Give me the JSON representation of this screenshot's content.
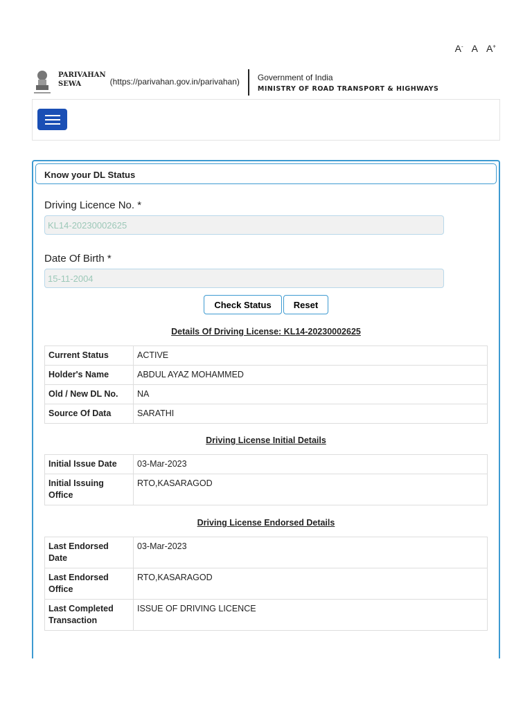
{
  "font_controls": {
    "decrease": "A",
    "decrease_sup": "-",
    "normal": "A",
    "increase": "A",
    "increase_sup": "+"
  },
  "header": {
    "brand_line1": "PARIVAHAN",
    "brand_line2": "SEWA",
    "url": "(https://parivahan.gov.in/parivahan)",
    "gov": "Government of India",
    "ministry": "MINISTRY OF ROAD TRANSPORT & HIGHWAYS"
  },
  "panel": {
    "title": "Know your DL Status",
    "dl_label": "Driving Licence No. *",
    "dl_value": "KL14-20230002625",
    "dob_label": "Date Of Birth *",
    "dob_value": "15-11-2004",
    "check_button": "Check Status",
    "reset_button": "Reset"
  },
  "sections": [
    {
      "title": "Details Of Driving License: KL14-20230002625",
      "rows": [
        [
          "Current Status",
          "ACTIVE"
        ],
        [
          "Holder's Name",
          "ABDUL AYAZ MOHAMMED"
        ],
        [
          "Old / New DL No.",
          "NA"
        ],
        [
          "Source Of Data",
          "SARATHI"
        ]
      ]
    },
    {
      "title": "Driving License Initial Details",
      "rows": [
        [
          "Initial Issue Date",
          "03-Mar-2023"
        ],
        [
          "Initial Issuing Office",
          "RTO,KASARAGOD"
        ]
      ]
    },
    {
      "title": "Driving License Endorsed Details",
      "rows": [
        [
          "Last Endorsed Date",
          "03-Mar-2023"
        ],
        [
          "Last Endorsed Office",
          "RTO,KASARAGOD"
        ],
        [
          "Last Completed Transaction",
          "ISSUE OF DRIVING LICENCE"
        ]
      ]
    }
  ]
}
